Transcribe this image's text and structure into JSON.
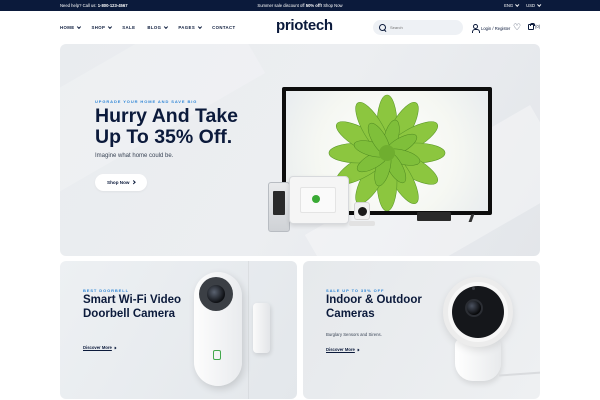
{
  "topbar": {
    "help_label": "Need help? Call us:",
    "phone": "1-800-123-4567",
    "promo_prefix": "Summer sale discount off",
    "promo_bold": "50% off!",
    "promo_link": "Shop Now",
    "language": "ENG",
    "currency": "USD"
  },
  "header": {
    "logo": "priotech",
    "nav": [
      "HOME",
      "SHOP",
      "SALE",
      "BLOG",
      "PAGES",
      "CONTACT"
    ],
    "search_placeholder": "Search",
    "account_label": "Login / Register",
    "cart_count": "(0)"
  },
  "hero": {
    "eyebrow": "UPGRADE YOUR HOME AND SAVE BIG",
    "title": "Hurry And Take Up To 35% Off.",
    "subtitle": "Imagine what home could be.",
    "button": "Shop Now"
  },
  "cards": [
    {
      "eyebrow": "BEST DOORBELL",
      "title": "Smart Wi-Fi Video Doorbell Camera",
      "subtitle": "",
      "link": "Discover More"
    },
    {
      "eyebrow": "SALE UP TO 35% OFF",
      "title": "Indoor & Outdoor Cameras",
      "subtitle": "Burglary Sensors and Sirens.",
      "link": "Discover More"
    }
  ],
  "icons": {
    "search": "search-icon",
    "user": "user-icon",
    "wishlist": "heart-icon",
    "cart": "shopping-bag-icon"
  },
  "colors": {
    "navy": "#0b1a3b",
    "accent_blue": "#2f86d6",
    "plant_green": "#7fbf3a"
  }
}
